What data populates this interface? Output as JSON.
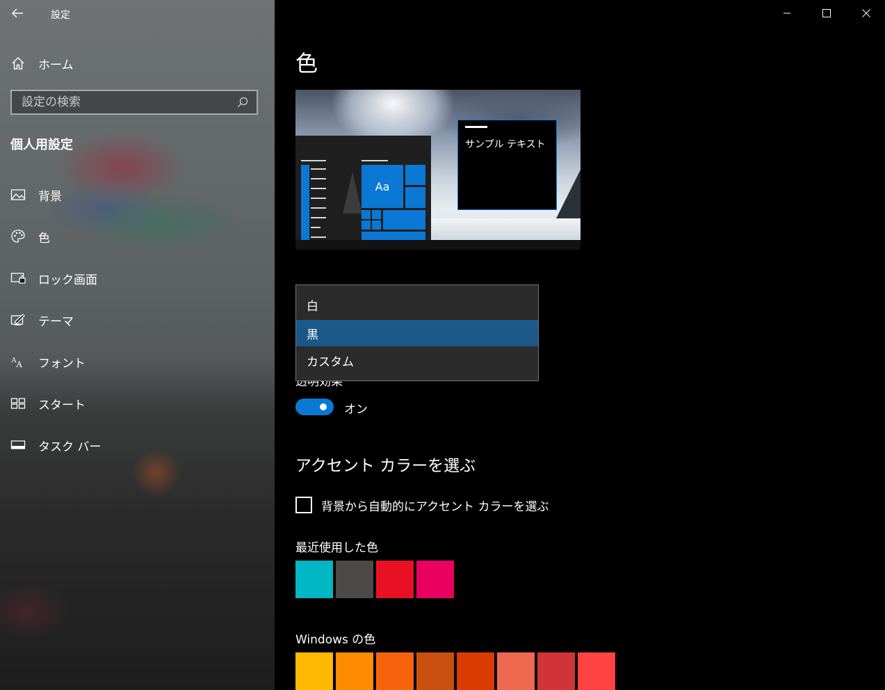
{
  "window": {
    "title": "設定",
    "controls": [
      "minimize-icon",
      "maximize-icon",
      "close-icon"
    ]
  },
  "sidebar": {
    "home_label": "ホーム",
    "search": {
      "placeholder": "設定の検索"
    },
    "section_title": "個人用設定",
    "items": [
      {
        "label": "背景",
        "icon": "picture-icon"
      },
      {
        "label": "色",
        "icon": "palette-icon"
      },
      {
        "label": "ロック画面",
        "icon": "lock-screen-icon"
      },
      {
        "label": "テーマ",
        "icon": "theme-icon"
      },
      {
        "label": "フォント",
        "icon": "font-icon"
      },
      {
        "label": "スタート",
        "icon": "start-icon"
      },
      {
        "label": "タスク バー",
        "icon": "taskbar-icon"
      }
    ]
  },
  "main": {
    "title": "色",
    "preview": {
      "sample_text": "サンプル テキスト",
      "tile_text": "Aa"
    },
    "color_mode_dropdown": {
      "options": [
        "白",
        "黒",
        "カスタム"
      ],
      "selected": "黒"
    },
    "transparency": {
      "label": "透明効果",
      "state": "オン",
      "on": true
    },
    "accent_heading": "アクセント カラーを選ぶ",
    "auto_accent_checkbox": {
      "label": "背景から自動的にアクセント カラーを選ぶ",
      "checked": false
    },
    "recent_colors_label": "最近使用した色",
    "recent_colors": [
      "#00b7c3",
      "#4c4a48",
      "#e81123",
      "#ea005e"
    ],
    "windows_colors_label": "Windows の色",
    "windows_colors": [
      "#ffb900",
      "#ff8c00",
      "#f7630c",
      "#ca5010",
      "#da3b01",
      "#ef6950",
      "#d13438",
      "#ff4343"
    ]
  },
  "colors": {
    "accent": "#0a78d4",
    "selection": "#1a5585"
  }
}
